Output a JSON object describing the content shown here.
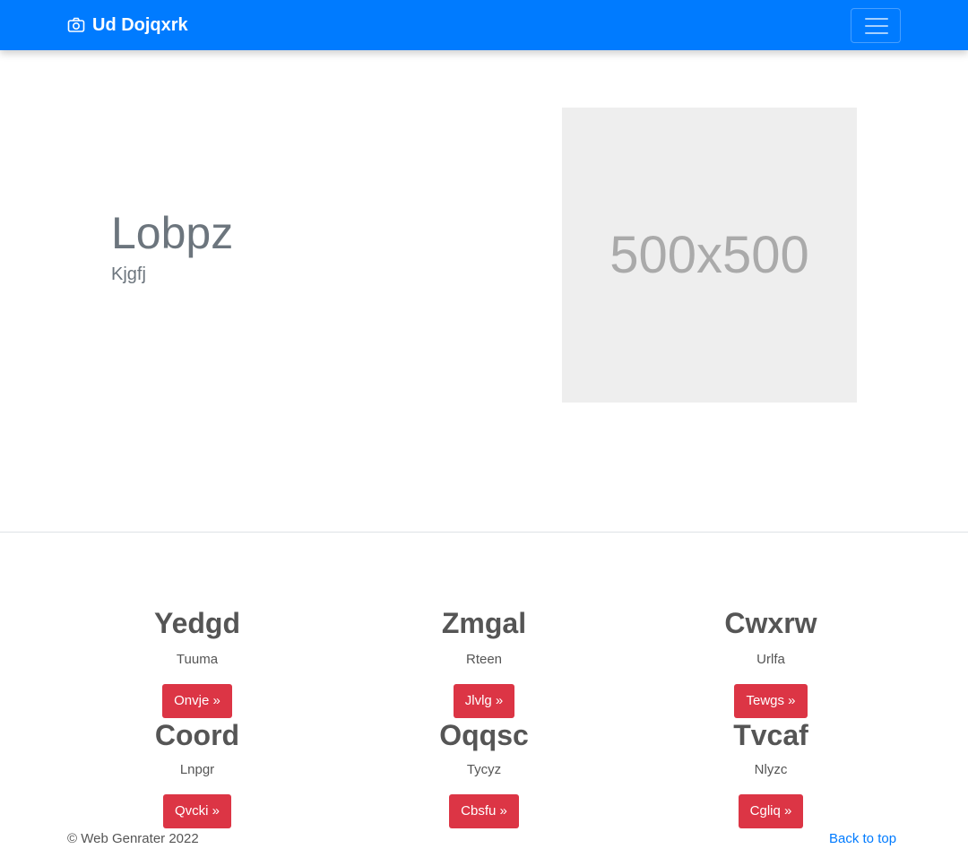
{
  "navbar": {
    "brand": "Ud Dojqxrk",
    "brand_icon": "camera-icon",
    "toggler_icon": "hamburger-menu-icon",
    "color": "#007bff"
  },
  "hero": {
    "title": "Lobpz",
    "subtitle": "Kjgfj",
    "image_placeholder": "500x500"
  },
  "features": [
    {
      "title": "Yedgd",
      "text": "Tuuma",
      "button": "Onvje »"
    },
    {
      "title": "Zmgal",
      "text": "Rteen",
      "button": "Jlvlg »"
    },
    {
      "title": "Cwxrw",
      "text": "Urlfa",
      "button": "Tewgs »"
    },
    {
      "title": "Coord",
      "text": "Lnpgr",
      "button": "Qvcki »"
    },
    {
      "title": "Oqqsc",
      "text": "Tycyz",
      "button": "Cbsfu »"
    },
    {
      "title": "Tvcaf",
      "text": "Nlyzc",
      "button": "Cgliq »"
    }
  ],
  "footer": {
    "copyright": "© Web Genrater 2022",
    "back_to_top": "Back to top"
  },
  "colors": {
    "button": "#dc3545",
    "link": "#007bff"
  }
}
